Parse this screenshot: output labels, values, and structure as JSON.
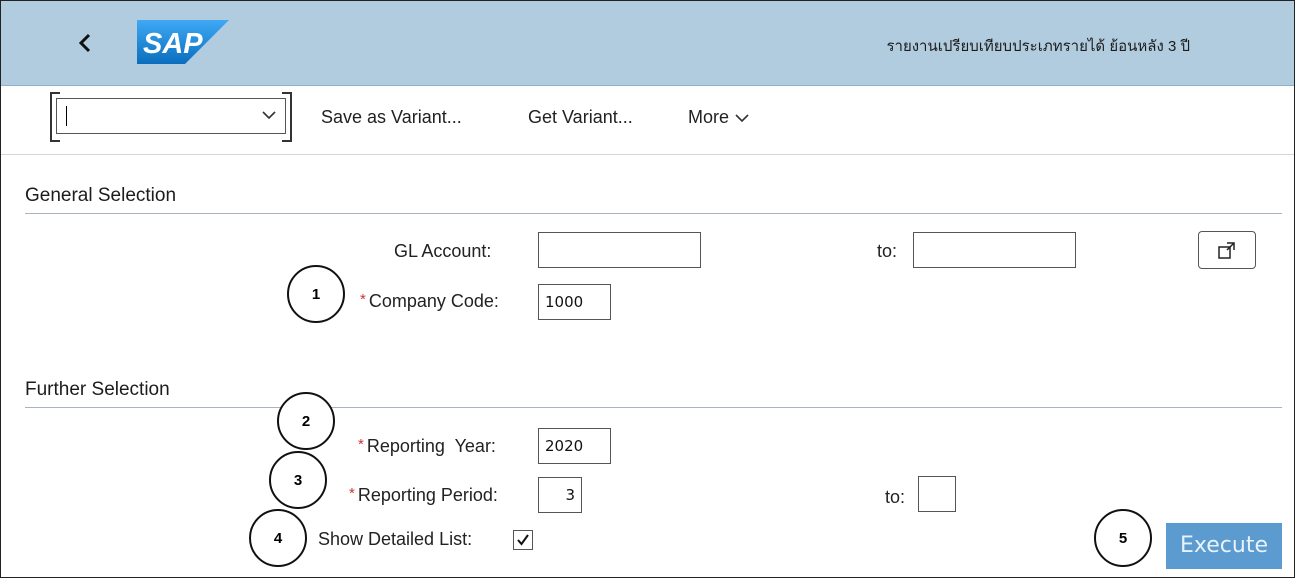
{
  "header": {
    "title": "รายงานเปรียบเทียบประเภทรายได้ ย้อนหลัง 3 ปี",
    "logo_text": "SAP",
    "back_icon": "chevron-left-icon",
    "background": "#b1ccdf"
  },
  "toolbar": {
    "variant_value": "",
    "save_variant_label": "Save as Variant...",
    "get_variant_label": "Get Variant...",
    "more_label": "More"
  },
  "general_selection": {
    "title": "General Selection",
    "gl_account_label": "GL Account:",
    "gl_account_from": "",
    "gl_account_to_label": "to:",
    "gl_account_to": "",
    "company_code_label": "Company Code:",
    "company_code_value": "1000",
    "multiple_selection_icon": "external-link-icon"
  },
  "further_selection": {
    "title": "Further Selection",
    "reporting_year_label": "Reporting  Year:",
    "reporting_year_value": "2020",
    "reporting_period_label": "Reporting Period:",
    "reporting_period_value": "3",
    "reporting_period_to_label": "to:",
    "reporting_period_to_value": "",
    "show_detailed_label": "Show Detailed List:",
    "show_detailed_checked": true
  },
  "execute_label": "Execute",
  "required_marker": "*",
  "annotations": [
    "1",
    "2",
    "3",
    "4",
    "5"
  ],
  "colors": {
    "execute_bg": "#5b9bd0",
    "required": "#cc3333"
  }
}
